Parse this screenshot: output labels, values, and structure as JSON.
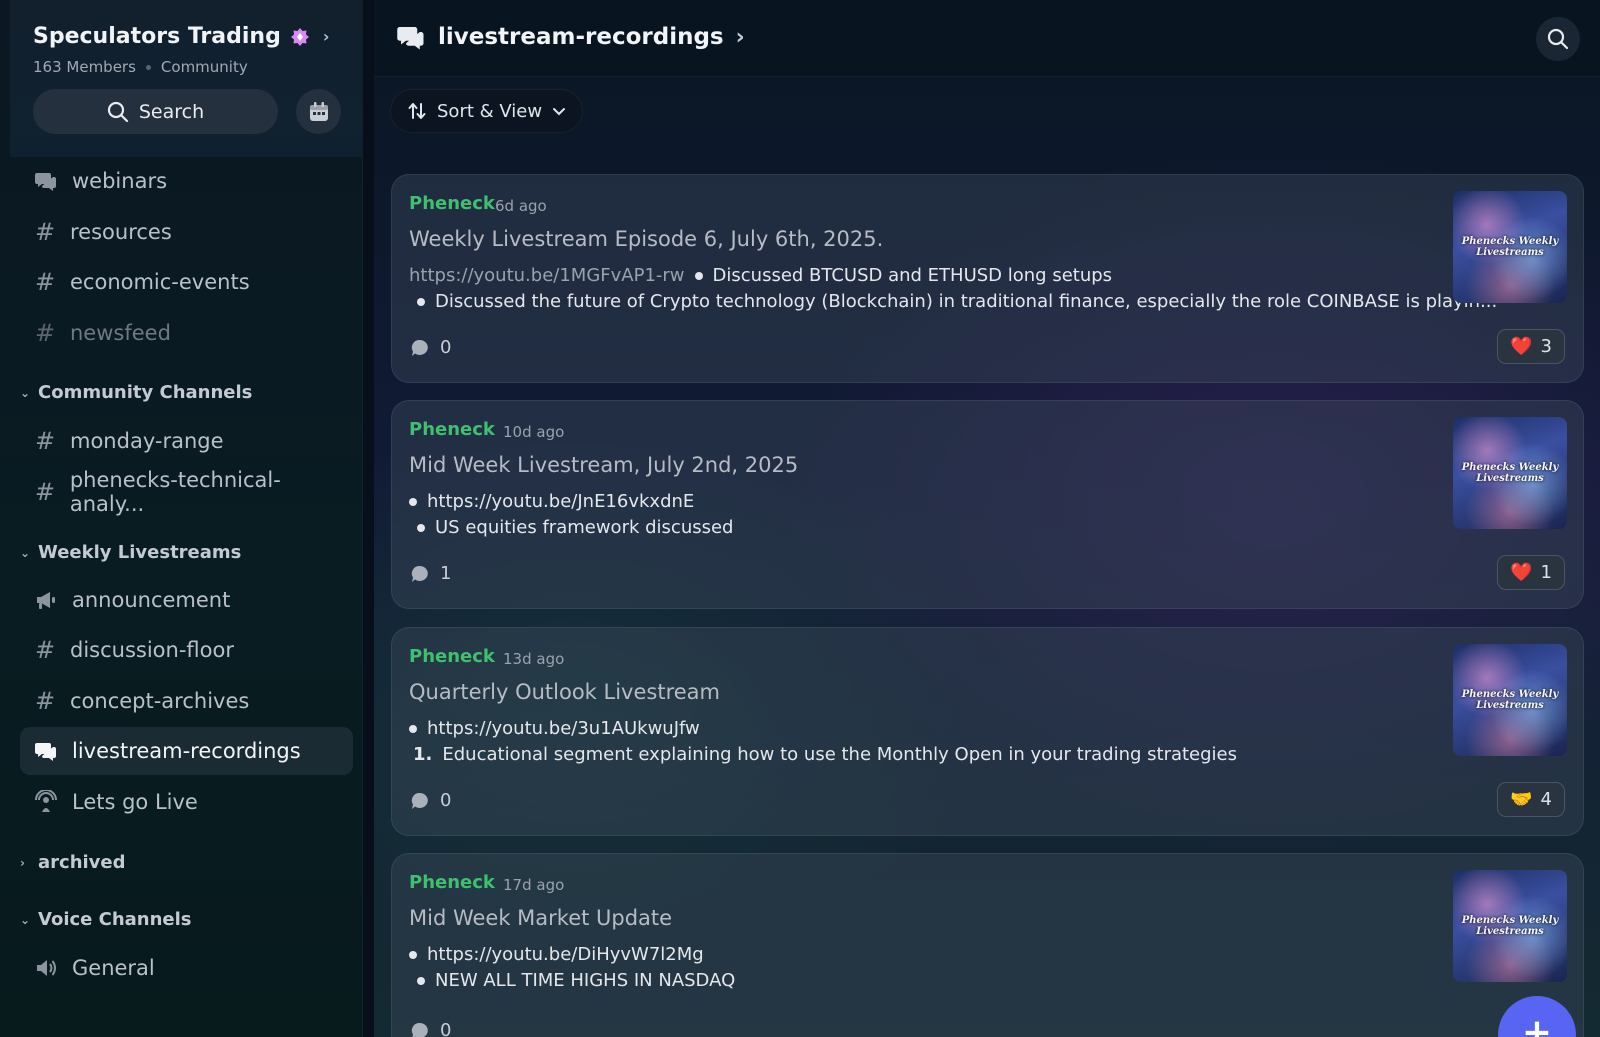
{
  "server": {
    "name": "Speculators Trading",
    "members": "163 Members",
    "type": "Community",
    "search_label": "Search"
  },
  "channels": {
    "top": [
      {
        "label": "webinars",
        "icon": "forum-icon",
        "muted": false
      },
      {
        "label": "resources",
        "icon": "hash-icon",
        "muted": false
      },
      {
        "label": "economic-events",
        "icon": "hash-icon",
        "muted": false
      },
      {
        "label": "newsfeed",
        "icon": "hash-icon",
        "muted": true
      }
    ],
    "community_label": "Community Channels",
    "community": [
      {
        "label": "monday-range",
        "icon": "hash-icon"
      },
      {
        "label": "phenecks-technical-analy...",
        "icon": "hash-icon"
      }
    ],
    "weekly_label": "Weekly Livestreams",
    "weekly": [
      {
        "label": "announcement",
        "icon": "megaphone-icon"
      },
      {
        "label": "discussion-floor",
        "icon": "hash-lock-icon"
      },
      {
        "label": "concept-archives",
        "icon": "hash-lock-icon"
      },
      {
        "label": "livestream-recordings",
        "icon": "forum-icon",
        "active": true
      },
      {
        "label": "Lets go Live",
        "icon": "stage-icon"
      }
    ],
    "archived_label": "archived",
    "voice_label": "Voice Channels",
    "voice": [
      {
        "label": "General",
        "icon": "speaker-icon"
      }
    ]
  },
  "header": {
    "channel": "livestream-recordings"
  },
  "toolbar": {
    "sort_label": "Sort & View"
  },
  "posts": [
    {
      "author": "Pheneck",
      "time": "6d ago",
      "title": "Weekly Livestream Episode 6, July 6th, 2025.",
      "link": "https://youtu.be/1MGFvAP1-rw",
      "line1": "Discussed BTCUSD and ETHUSD long setups",
      "line2": "Discussed the future of Crypto technology (Blockchain) in traditional finance, especially the role COINBASE is playin...",
      "comments": "0",
      "reaction_count": "3",
      "reaction_emoji": "❤️",
      "thumb_text": "Phenecks Weekly Livestreams"
    },
    {
      "author": "Pheneck",
      "time": "10d ago",
      "title": "Mid Week Livestream, July 2nd, 2025",
      "link": "https://youtu.be/JnE16vkxdnE",
      "line2": "US equities framework discussed",
      "comments": "1",
      "reaction_count": "1",
      "reaction_emoji": "❤️",
      "thumb_text": "Phenecks Weekly Livestreams"
    },
    {
      "author": "Pheneck",
      "time": "13d ago",
      "title": "Quarterly Outlook Livestream",
      "link": "https://youtu.be/3u1AUkwuJfw",
      "list_num": "1.",
      "line2": "Educational segment explaining how to use the Monthly Open in your trading strategies",
      "comments": "0",
      "reaction_count": "4",
      "reaction_emoji": "🤝",
      "thumb_text": "Phenecks Weekly Livestreams"
    },
    {
      "author": "Pheneck",
      "time": "17d ago",
      "title": "Mid Week Market Update",
      "link": "https://youtu.be/DiHyvW7l2Mg",
      "line2": "NEW ALL TIME HIGHS IN NASDAQ",
      "comments": "0",
      "thumb_text": "Phenecks Weekly Livestreams"
    }
  ],
  "fab_label": "+",
  "colors": {
    "accent": "#5865f2",
    "author": "#3fbf6f"
  }
}
